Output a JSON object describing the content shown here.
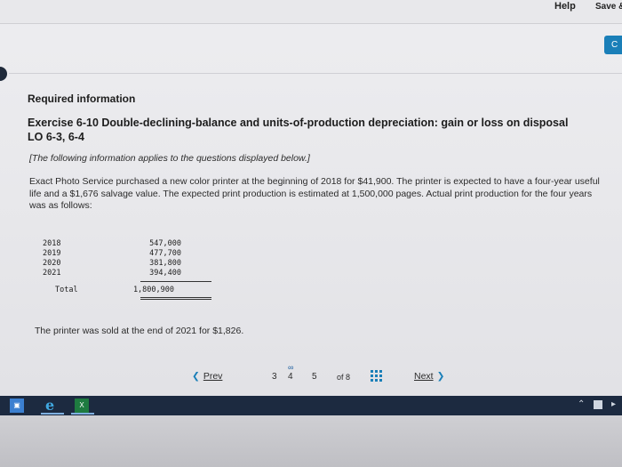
{
  "header": {
    "help_label": "Help",
    "save_label": "Save &",
    "check_label": "C"
  },
  "content": {
    "required_info": "Required information",
    "exercise_title": "Exercise 6-10 Double-declining-balance and units-of-production depreciation: gain or loss on disposal LO 6-3, 6-4",
    "note": "[The following information applies to the questions displayed below.]",
    "body": "Exact Photo Service purchased a new color printer at the beginning of 2018 for $41,900. The printer is expected to have a four-year useful life and a $1,676 salvage value. The expected print production is estimated at 1,500,000 pages. Actual print production for the four years was as follows:",
    "production": {
      "rows": [
        {
          "year": "2018",
          "pages": "547,000"
        },
        {
          "year": "2019",
          "pages": "477,700"
        },
        {
          "year": "2020",
          "pages": "381,800"
        },
        {
          "year": "2021",
          "pages": "394,400"
        }
      ],
      "total_label": "Total",
      "total_value": "1,800,900"
    },
    "sold_text": "The printer was sold at the end of 2021 for $1,826."
  },
  "pager": {
    "prev_label": "Prev",
    "pages": [
      "3",
      "4",
      "5"
    ],
    "of_label": "of 8",
    "next_label": "Next"
  },
  "colors": {
    "accent": "#1a7fb8",
    "taskbar": "#1c2a40"
  },
  "icons": {
    "windows": "windows-icon",
    "browser": "edge-icon",
    "excel": "excel-icon",
    "grid": "grid-icon"
  }
}
